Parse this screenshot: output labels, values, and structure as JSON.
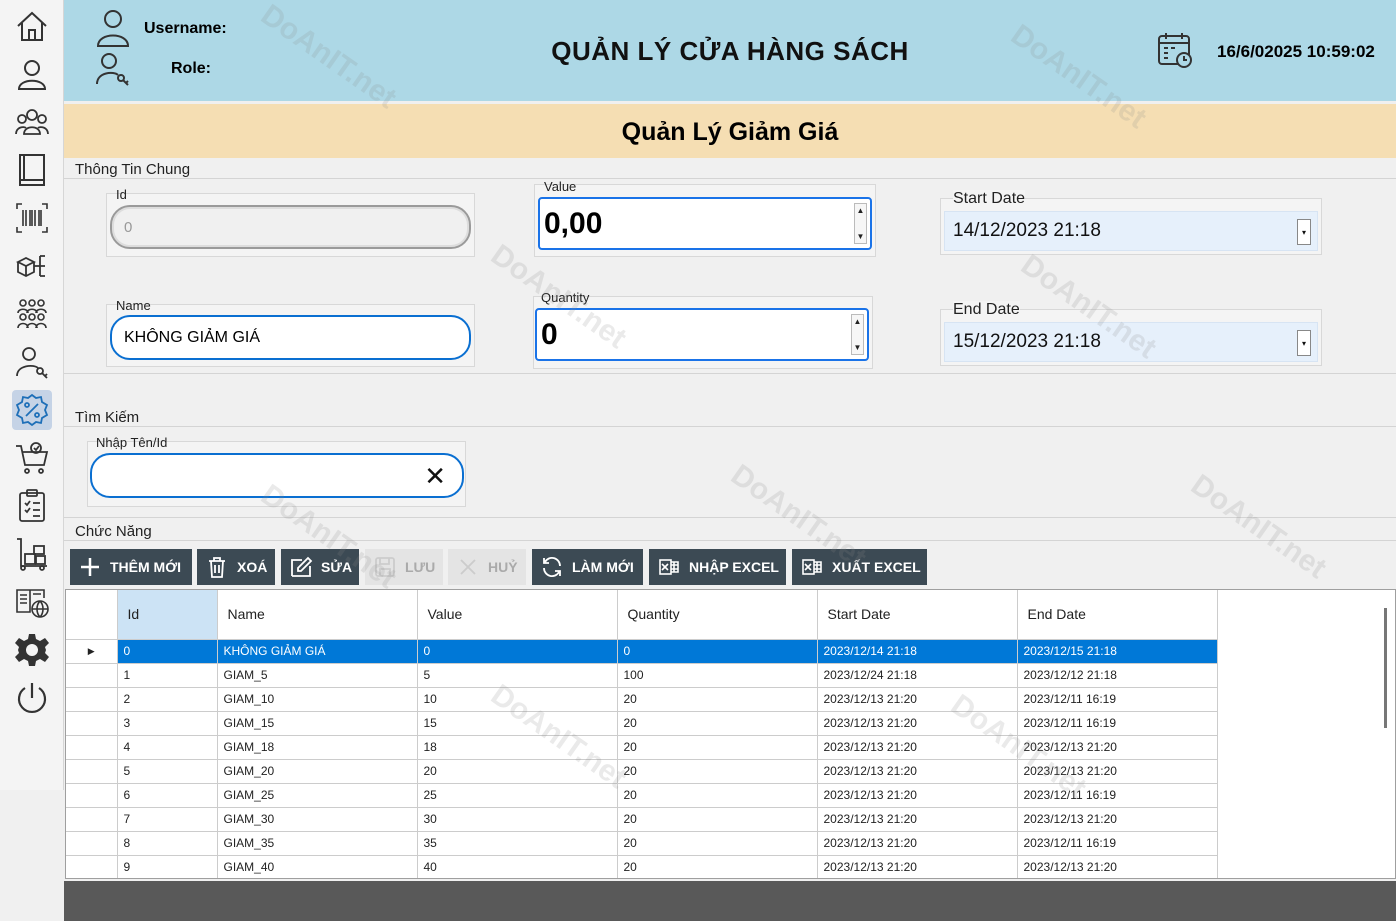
{
  "header": {
    "username_label": "Username:",
    "role_label": "Role:",
    "title": "QUẢN LÝ CỬA HÀNG SÁCH",
    "datetime": "16/6/02025 10:59:02"
  },
  "section": {
    "title": "Quản Lý Giảm Giá"
  },
  "info": {
    "group_label": "Thông Tin Chung",
    "id_label": "Id",
    "id_value": "0",
    "value_label": "Value",
    "value_value": "0,00",
    "start_label": "Start Date",
    "start_value": "14/12/2023 21:18",
    "name_label": "Name",
    "name_value": "KHÔNG GIẢM GIÁ",
    "quantity_label": "Quantity",
    "quantity_value": "0",
    "end_label": "End Date",
    "end_value": "15/12/2023 21:18"
  },
  "search": {
    "group_label": "Tìm Kiếm",
    "field_label": "Nhập Tên/Id",
    "value": ""
  },
  "actions": {
    "group_label": "Chức Năng",
    "add": "THÊM MỚI",
    "delete": "XOÁ",
    "edit": "SỬA",
    "save": "LƯU",
    "cancel": "HUỶ",
    "refresh": "LÀM MỚI",
    "import": "NHẬP EXCEL",
    "export": "XUẤT EXCEL"
  },
  "grid": {
    "columns": [
      "Id",
      "Name",
      "Value",
      "Quantity",
      "Start Date",
      "End Date"
    ],
    "rows": [
      [
        "0",
        "KHÔNG GIẢM GIÁ",
        "0",
        "0",
        "2023/12/14 21:18",
        "2023/12/15 21:18"
      ],
      [
        "1",
        "GIAM_5",
        "5",
        "100",
        "2023/12/24 21:18",
        "2023/12/12 21:18"
      ],
      [
        "2",
        "GIAM_10",
        "10",
        "20",
        "2023/12/13 21:20",
        "2023/12/11 16:19"
      ],
      [
        "3",
        "GIAM_15",
        "15",
        "20",
        "2023/12/13 21:20",
        "2023/12/11 16:19"
      ],
      [
        "4",
        "GIAM_18",
        "18",
        "20",
        "2023/12/13 21:20",
        "2023/12/13 21:20"
      ],
      [
        "5",
        "GIAM_20",
        "20",
        "20",
        "2023/12/13 21:20",
        "2023/12/13 21:20"
      ],
      [
        "6",
        "GIAM_25",
        "25",
        "20",
        "2023/12/13 21:20",
        "2023/12/11 16:19"
      ],
      [
        "7",
        "GIAM_30",
        "30",
        "20",
        "2023/12/13 21:20",
        "2023/12/13 21:20"
      ],
      [
        "8",
        "GIAM_35",
        "35",
        "20",
        "2023/12/13 21:20",
        "2023/12/11 16:19"
      ],
      [
        "9",
        "GIAM_40",
        "40",
        "20",
        "2023/12/13 21:20",
        "2023/12/13 21:20"
      ]
    ],
    "selected_row": 0
  },
  "sidebar": {
    "icons": [
      "home-icon",
      "user-icon",
      "users-group-icon",
      "book-icon",
      "barcode-icon",
      "category-icon",
      "customers-icon",
      "user-key-icon",
      "discount-icon",
      "cart-icon",
      "clipboard-icon",
      "inventory-icon",
      "catalog-icon",
      "settings-icon",
      "power-icon"
    ]
  },
  "watermark": "DoAnIT.net",
  "colors": {
    "header": "#add8e6",
    "section": "#f5deb3",
    "button": "#3c4a54",
    "selection": "#0078d7",
    "footer": "#595959"
  }
}
